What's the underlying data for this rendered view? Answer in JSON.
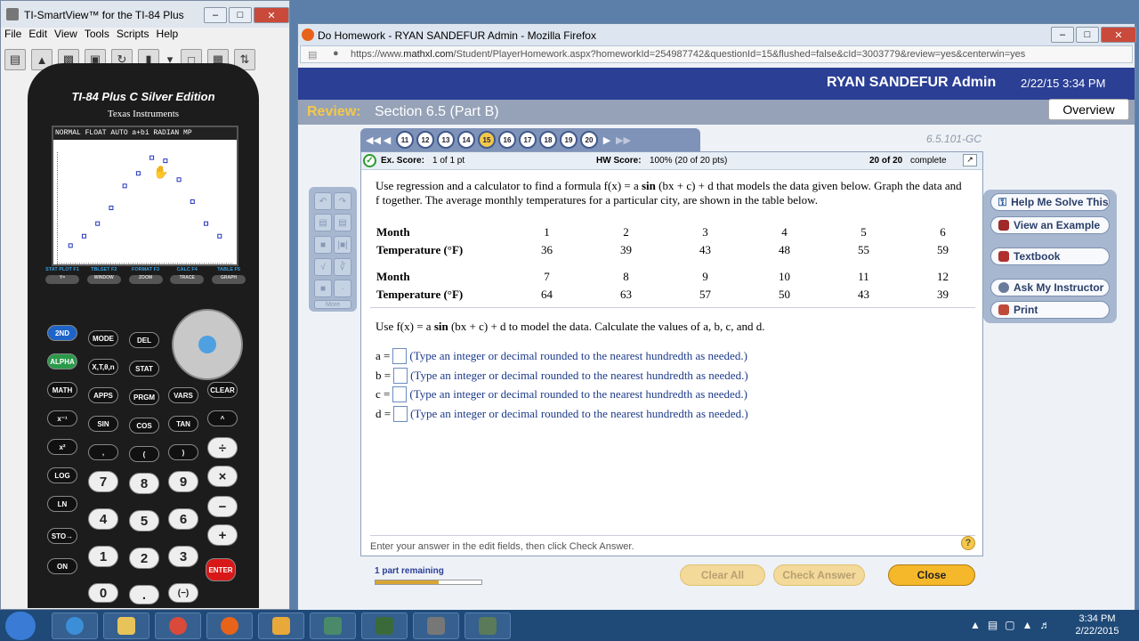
{
  "ti_window": {
    "title": "TI-SmartView™ for the TI-84 Plus",
    "menu": [
      "File",
      "Edit",
      "View",
      "Tools",
      "Scripts",
      "Help"
    ],
    "model_name": "TI-84 Plus C Silver Edition",
    "maker": "Texas Instruments",
    "status_line": "NORMAL FLOAT AUTO a+bi RADIAN MP",
    "fkey_labels": [
      {
        "top": "STAT PLOT F1",
        "label": "Y="
      },
      {
        "top": "TBLSET F2",
        "label": "WINDOW"
      },
      {
        "top": "FORMAT F3",
        "label": "ZOOM"
      },
      {
        "top": "CALC F4",
        "label": "TRACE"
      },
      {
        "top": "TABLE F5",
        "label": "GRAPH"
      }
    ],
    "keys": {
      "second": "2ND",
      "mode": "MODE",
      "del": "DEL",
      "alpha": "ALPHA",
      "xton": "X,T,θ,n",
      "stat": "STAT",
      "math": "MATH",
      "apps": "APPS",
      "prgm": "PRGM",
      "vars": "VARS",
      "clear": "CLEAR",
      "inv": "x⁻¹",
      "sin": "SIN",
      "cos": "COS",
      "tan": "TAN",
      "pow": "^",
      "sq": "x²",
      "comma": ",",
      "lparen": "(",
      "rparen": ")",
      "div": "÷",
      "log": "LOG",
      "k7": "7",
      "k8": "8",
      "k9": "9",
      "mul": "×",
      "ln": "LN",
      "k4": "4",
      "k5": "5",
      "k6": "6",
      "sub": "−",
      "sto": "STO→",
      "k1": "1",
      "k2": "2",
      "k3": "3",
      "add": "+",
      "on": "ON",
      "k0": "0",
      "dot": ".",
      "neg": "(−)",
      "enter": "ENTER"
    },
    "plot_points": [
      [
        1,
        36
      ],
      [
        2,
        39
      ],
      [
        3,
        43
      ],
      [
        4,
        48
      ],
      [
        5,
        55
      ],
      [
        6,
        59
      ],
      [
        7,
        64
      ],
      [
        8,
        63
      ],
      [
        9,
        57
      ],
      [
        10,
        50
      ],
      [
        11,
        43
      ],
      [
        12,
        39
      ]
    ]
  },
  "firefox": {
    "title": "Do Homework - RYAN SANDEFUR Admin - Mozilla Firefox",
    "url_prefix": "https://www.",
    "url_domain": "mathxl.com",
    "url_rest": "/Student/PlayerHomework.aspx?homeworkId=254987742&questionId=15&flushed=false&cId=3003779&review=yes&centerwin=yes"
  },
  "header": {
    "user": "RYAN SANDEFUR Admin",
    "datetime": "2/22/15 3:34 PM"
  },
  "review": {
    "label": "Review:",
    "section": "Section 6.5 (Part B)",
    "overview": "Overview"
  },
  "qnav": {
    "numbers": [
      "11",
      "12",
      "13",
      "14",
      "15",
      "16",
      "17",
      "18",
      "19",
      "20"
    ],
    "current": "15",
    "qid": "6.5.101-GC"
  },
  "scores": {
    "ex_label": "Ex. Score:",
    "ex_value": "1 of 1 pt",
    "hw_label": "HW Score:",
    "hw_value": "100% (20 of 20 pts)",
    "complete_bold": "20 of 20",
    "complete_rest": "complete"
  },
  "problem": {
    "intro_a": "Use regression and a calculator to find a formula f(x) = a ",
    "intro_sin": "sin",
    "intro_b": " (bx + c) + d that models the data given below. Graph the data and f together. The average monthly temperatures for a particular city, are shown in the table below.",
    "row_month": "Month",
    "row_temp": "Temperature (°F)",
    "months_1": [
      "1",
      "2",
      "3",
      "4",
      "5",
      "6"
    ],
    "temps_1": [
      "36",
      "39",
      "43",
      "48",
      "55",
      "59"
    ],
    "months_2": [
      "7",
      "8",
      "9",
      "10",
      "11",
      "12"
    ],
    "temps_2": [
      "64",
      "63",
      "57",
      "50",
      "43",
      "39"
    ],
    "use_a": "Use f(x) = a ",
    "use_sin": "sin",
    "use_b": " (bx + c) + d to model the data. Calculate the values of a, b, c, and d.",
    "answers": [
      {
        "label": "a =",
        "hint": "(Type an integer or decimal rounded to the nearest hundredth as needed.)"
      },
      {
        "label": "b =",
        "hint": "(Type an integer or decimal rounded to the nearest hundredth as needed.)"
      },
      {
        "label": "c =",
        "hint": "(Type an integer or decimal rounded to the nearest hundredth as needed.)"
      },
      {
        "label": "d =",
        "hint": "(Type an integer or decimal rounded to the nearest hundredth as needed.)"
      }
    ],
    "footer": "Enter your answer in the edit fields, then click Check Answer.",
    "help_mark": "?"
  },
  "tools": {
    "more": "More"
  },
  "sidebar": {
    "help": "Help Me Solve This",
    "example": "View an Example",
    "textbook": "Textbook",
    "instructor": "Ask My Instructor",
    "print": "Print"
  },
  "bottom": {
    "remaining": "1 part remaining",
    "progress": 0.6,
    "clear": "Clear All",
    "check": "Check Answer",
    "close": "Close"
  },
  "taskbar": {
    "time": "3:34 PM",
    "date": "2/22/2015"
  },
  "colors": {
    "brand": "#2b3f95",
    "accent": "#f5c84a",
    "plot_point": "#2233bb"
  }
}
